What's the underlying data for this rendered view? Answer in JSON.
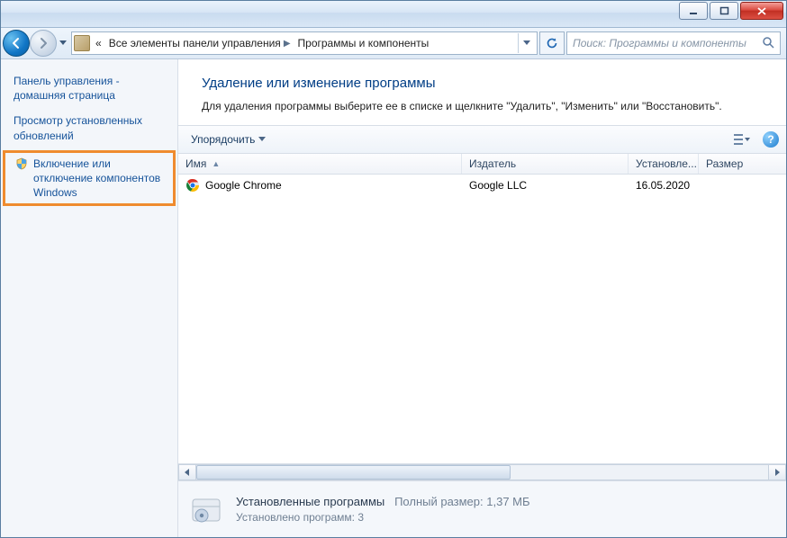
{
  "titlebar": {},
  "breadcrumb": {
    "chevrons_label": "«",
    "level1": "Все элементы панели управления",
    "level2": "Программы и компоненты"
  },
  "search": {
    "placeholder": "Поиск: Программы и компоненты"
  },
  "sidebar": {
    "items": [
      {
        "label": "Панель управления - домашняя страница",
        "shield": false
      },
      {
        "label": "Просмотр установленных обновлений",
        "shield": false
      },
      {
        "label": "Включение или отключение компонентов Windows",
        "shield": true,
        "highlight": true
      }
    ]
  },
  "header": {
    "title": "Удаление или изменение программы",
    "description": "Для удаления программы выберите ее в списке и щелкните \"Удалить\", \"Изменить\" или \"Восстановить\"."
  },
  "toolbar": {
    "organize": "Упорядочить"
  },
  "columns": {
    "name": "Имя",
    "publisher": "Издатель",
    "installed": "Установле...",
    "size": "Размер"
  },
  "rows": [
    {
      "name": "Google Chrome",
      "publisher": "Google LLC",
      "installed": "16.05.2020",
      "size": ""
    }
  ],
  "details": {
    "title": "Установленные программы",
    "total_label": "Полный размер:",
    "total_size": "1,37 МБ",
    "count_label": "Установлено программ:",
    "count": "3"
  }
}
